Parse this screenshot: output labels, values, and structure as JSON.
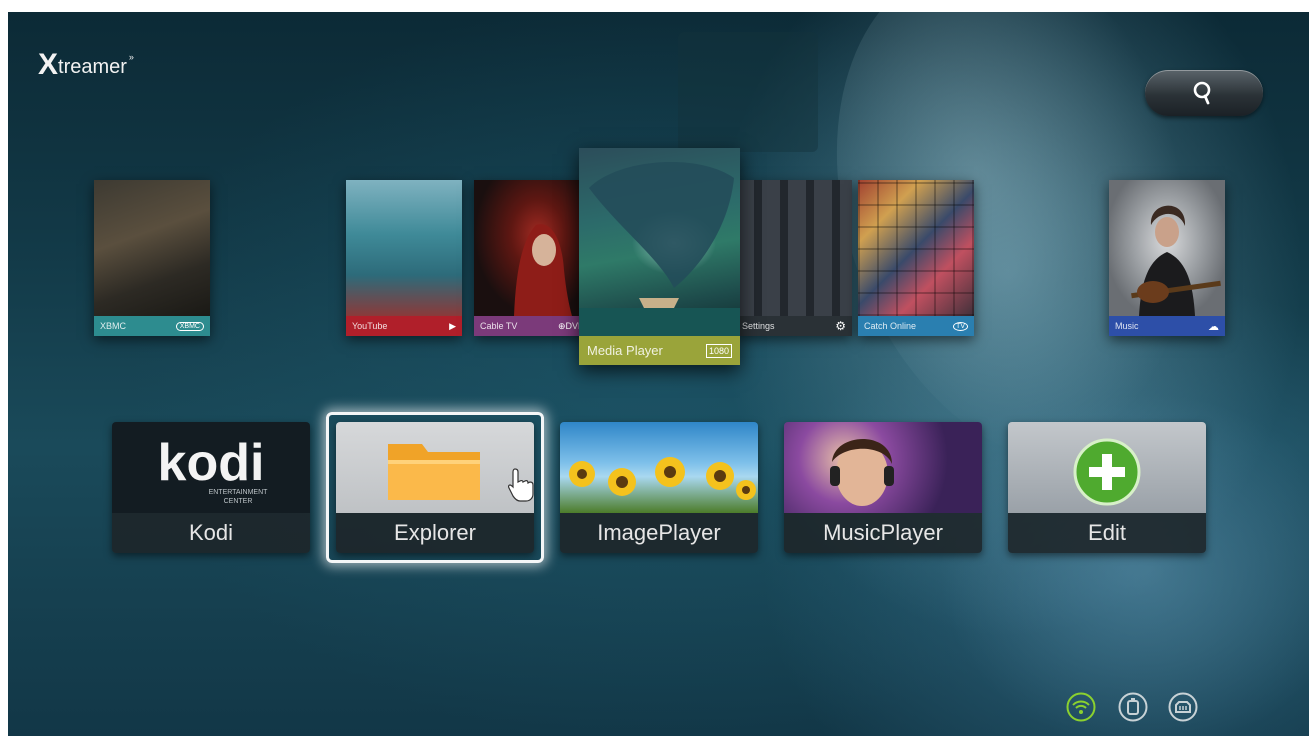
{
  "brand": {
    "x": "X",
    "rest": "treamer",
    "signal": "»"
  },
  "search": {
    "icon": "search-icon"
  },
  "carousel": [
    {
      "id": "xbmc",
      "label": "XBMC",
      "badge": "XBMC",
      "color": "#2d8c8f"
    },
    {
      "id": "youtube",
      "label": "YouTube",
      "badge": "▶",
      "color": "#b01f2a"
    },
    {
      "id": "cabletv",
      "label": "Cable TV",
      "badge": "⊕DVB",
      "color": "#7b3a7a"
    },
    {
      "id": "mediaplayer",
      "label": "Media Player",
      "badge": "1080",
      "color": "#9aa43a"
    },
    {
      "id": "settings",
      "label": "Settings",
      "badge": "⚙",
      "color": "#2a3136"
    },
    {
      "id": "catchonline",
      "label": "Catch Online",
      "badge": "TV",
      "color": "#2a7fb0"
    },
    {
      "id": "music",
      "label": "Music",
      "badge": "☁",
      "color": "#2d4fa8"
    }
  ],
  "apps": [
    {
      "id": "kodi",
      "label": "Kodi",
      "logo": "kodi",
      "sub1": "ENTERTAINMENT",
      "sub2": "CENTER"
    },
    {
      "id": "explorer",
      "label": "Explorer"
    },
    {
      "id": "imageplayer",
      "label": "ImagePlayer"
    },
    {
      "id": "musicplayer",
      "label": "MusicPlayer"
    },
    {
      "id": "edit",
      "label": "Edit"
    }
  ],
  "status": {
    "wifi_color": "#8bd12f",
    "icons": [
      "wifi-icon",
      "usb-storage-icon",
      "ethernet-icon"
    ]
  }
}
